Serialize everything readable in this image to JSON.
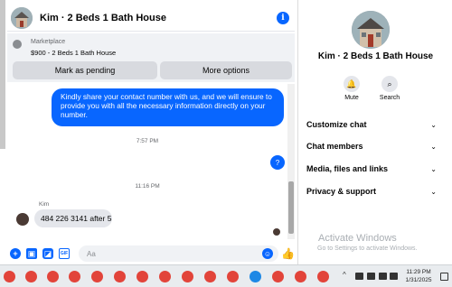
{
  "chat": {
    "title": "Kim · 2 Beds 1 Bath House",
    "info_icon": "i"
  },
  "marketplace": {
    "label": "Marketplace",
    "price_listing": "$900 - 2 Beds 1 Bath House",
    "mark_pending": "Mark as pending",
    "more_options": "More options"
  },
  "messages": {
    "outgoing_long": "Kindly share your contact number with us, and we will ensure to provide you with all the necessary information directly on your number.",
    "time1": "7:57 PM",
    "outgoing_q": "?",
    "time2": "11:16 PM",
    "sender": "Kim",
    "incoming": "484 226 3141 after 5"
  },
  "composer": {
    "placeholder": "Aa"
  },
  "info_pane": {
    "title": "Kim · 2 Beds 1 Bath House",
    "mute": "Mute",
    "search": "Search",
    "sections": [
      "Customize chat",
      "Chat members",
      "Media, files and links",
      "Privacy & support"
    ]
  },
  "watermark": {
    "title": "Activate Windows",
    "subtitle": "Go to Settings to activate Windows."
  },
  "taskbar": {
    "time": "11:29 PM",
    "date": "1/31/2025"
  },
  "colors": {
    "accent": "#0866ff",
    "bubble_in": "#e4e6eb",
    "panel_grey": "#f0f2f5"
  }
}
